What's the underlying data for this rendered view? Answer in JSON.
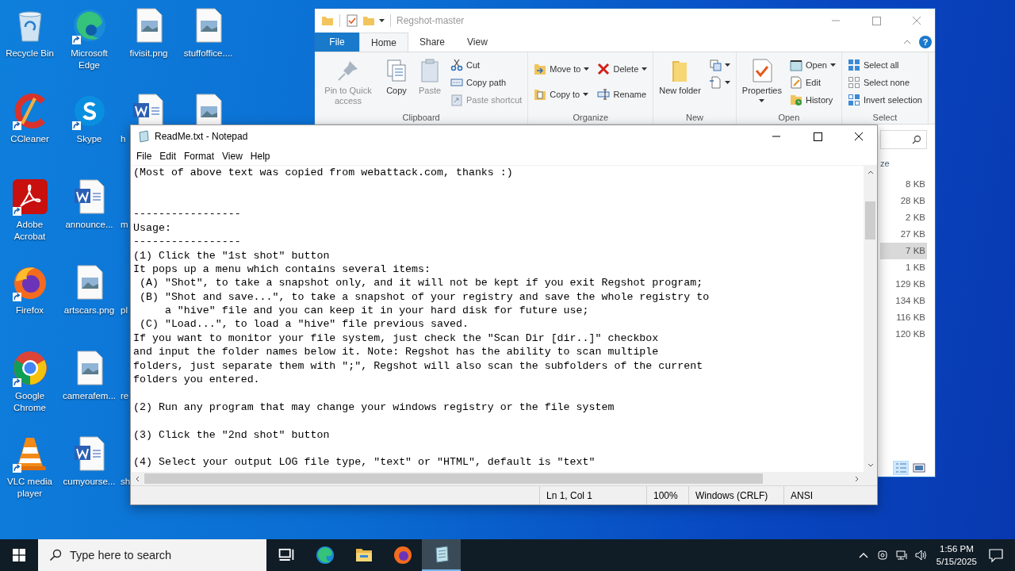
{
  "desktop": {
    "columns": [
      [
        {
          "label": "Recycle Bin",
          "shortcut": false
        },
        {
          "label": "CCleaner",
          "shortcut": true
        },
        {
          "label": "Adobe Acrobat",
          "shortcut": true
        },
        {
          "label": "Firefox",
          "shortcut": true
        },
        {
          "label": "Google Chrome",
          "shortcut": true
        },
        {
          "label": "VLC media player",
          "shortcut": true
        }
      ],
      [
        {
          "label": "Microsoft Edge",
          "shortcut": true
        },
        {
          "label": "Skype",
          "shortcut": true
        },
        {
          "label": "announce...",
          "shortcut": false
        },
        {
          "label": "artscars.png",
          "shortcut": false
        },
        {
          "label": "camerafem...",
          "shortcut": false
        },
        {
          "label": "cumyourse...",
          "shortcut": false
        }
      ],
      [
        {
          "label": "fivisit.png",
          "shortcut": false
        },
        {
          "label": "h",
          "shortcut": false,
          "cut": true
        },
        {
          "label": "m",
          "cut": true
        },
        {
          "label": "pl",
          "cut": true
        },
        {
          "label": "re",
          "cut": true
        },
        {
          "label": "sh",
          "cut": true
        }
      ],
      [
        {
          "label": "stuffoffice....",
          "shortcut": false
        },
        {
          "shortcut": false
        }
      ]
    ]
  },
  "explorer": {
    "title": "Regshot-master",
    "tabs": [
      {
        "label": "File",
        "kind": "file",
        "selected": false
      },
      {
        "label": "Home",
        "kind": "tab",
        "selected": true
      },
      {
        "label": "Share",
        "kind": "tab",
        "selected": false
      },
      {
        "label": "View",
        "kind": "tab",
        "selected": false
      }
    ],
    "help_button": "?",
    "ribbon": [
      {
        "label": "Clipboard",
        "columns": [
          [
            {
              "kind": "large",
              "label": "Pin to Quick access",
              "disabled": true
            }
          ],
          [
            {
              "kind": "large",
              "label": "Copy",
              "disabled": false
            }
          ],
          [
            {
              "kind": "large",
              "label": "Paste",
              "disabled": true
            }
          ],
          [
            {
              "kind": "small",
              "label": "Cut",
              "disabled": false
            },
            {
              "kind": "small",
              "label": "Copy path",
              "disabled": false
            },
            {
              "kind": "small",
              "label": "Paste shortcut",
              "disabled": true
            }
          ]
        ]
      },
      {
        "label": "Organize",
        "columns": [
          [
            {
              "kind": "medium",
              "label": "Move to",
              "dropdown": true
            },
            {
              "kind": "medium",
              "label": "Copy to",
              "dropdown": true
            }
          ],
          [
            {
              "kind": "medium",
              "label": "Delete",
              "dropdown": true
            },
            {
              "kind": "medium",
              "label": "Rename"
            }
          ]
        ]
      },
      {
        "label": "New",
        "columns": [
          [
            {
              "kind": "large",
              "label": "New folder"
            }
          ],
          [
            {
              "kind": "icon",
              "dropdown": true
            },
            {
              "kind": "icon",
              "dropdown": true
            }
          ]
        ]
      },
      {
        "label": "Open",
        "columns": [
          [
            {
              "kind": "large",
              "label": "Properties",
              "dropdown": true
            }
          ],
          [
            {
              "kind": "small",
              "label": "Open",
              "dropdown": true
            },
            {
              "kind": "small",
              "label": "Edit"
            },
            {
              "kind": "small",
              "label": "History"
            }
          ]
        ]
      },
      {
        "label": "Select",
        "columns": [
          [
            {
              "kind": "small",
              "label": "Select all"
            },
            {
              "kind": "small",
              "label": "Select none"
            },
            {
              "kind": "small",
              "label": "Invert selection"
            }
          ]
        ]
      }
    ],
    "size_header": "ze",
    "sizes": [
      {
        "text": "8 KB",
        "selected": false
      },
      {
        "text": "28 KB",
        "selected": false
      },
      {
        "text": "2 KB",
        "selected": false
      },
      {
        "text": "27 KB",
        "selected": false
      },
      {
        "text": "7 KB",
        "selected": true
      },
      {
        "text": "1 KB",
        "selected": false
      },
      {
        "text": "129 KB",
        "selected": false
      },
      {
        "text": "134 KB",
        "selected": false
      },
      {
        "text": "116 KB",
        "selected": false
      },
      {
        "text": "120 KB",
        "selected": false
      }
    ]
  },
  "notepad": {
    "title": "ReadMe.txt - Notepad",
    "menu": [
      "File",
      "Edit",
      "Format",
      "View",
      "Help"
    ],
    "lines": [
      {
        "kind": "text",
        "text": "(Most of above text was copied from webattack.com, thanks :)"
      },
      {
        "kind": "blank"
      },
      {
        "kind": "blank"
      },
      {
        "kind": "text",
        "text": "-----------------"
      },
      {
        "kind": "text",
        "text": "Usage:"
      },
      {
        "kind": "text",
        "text": "-----------------"
      },
      {
        "kind": "text",
        "text": "(1) Click the \"1st shot\" button"
      },
      {
        "kind": "text",
        "text": "It pops up a menu which contains several items:"
      },
      {
        "kind": "text",
        "text": " (A) \"Shot\", to take a snapshot only, and it will not be kept if you exit Regshot program;"
      },
      {
        "kind": "text",
        "text": " (B) \"Shot and save...\", to take a snapshot of your registry and save the whole registry to"
      },
      {
        "kind": "text",
        "text": "     a \"hive\" file and you can keep it in your hard disk for future use;"
      },
      {
        "kind": "text",
        "text": " (C) \"Load...\", to load a \"hive\" file previous saved."
      },
      {
        "kind": "text",
        "text": "If you want to monitor your file system, just check the \"Scan Dir [dir..]\" checkbox"
      },
      {
        "kind": "text",
        "text": "and input the folder names below it. Note: Regshot has the ability to scan multiple"
      },
      {
        "kind": "text",
        "text": "folders, just separate them with \";\", Regshot will also scan the subfolders of the current"
      },
      {
        "kind": "text",
        "text": "folders you entered."
      },
      {
        "kind": "blank"
      },
      {
        "kind": "text",
        "text": "(2) Run any program that may change your windows registry or the file system"
      },
      {
        "kind": "blank"
      },
      {
        "kind": "text",
        "text": "(3) Click the \"2nd shot\" button"
      },
      {
        "kind": "blank"
      },
      {
        "kind": "text",
        "text": "(4) Select your output LOG file type, \"text\" or \"HTML\", default is \"text\""
      }
    ],
    "status": [
      "Ln 1, Col 1",
      "100%",
      "Windows (CRLF)",
      "ANSI"
    ]
  },
  "taskbar": {
    "search": {
      "placeholder": "Type here to search"
    },
    "apps": [
      {
        "selected": false
      },
      {
        "selected": false
      },
      {
        "selected": false
      },
      {
        "selected": false
      },
      {
        "selected": true
      }
    ],
    "time": "1:56 PM",
    "date": "5/15/2025"
  }
}
